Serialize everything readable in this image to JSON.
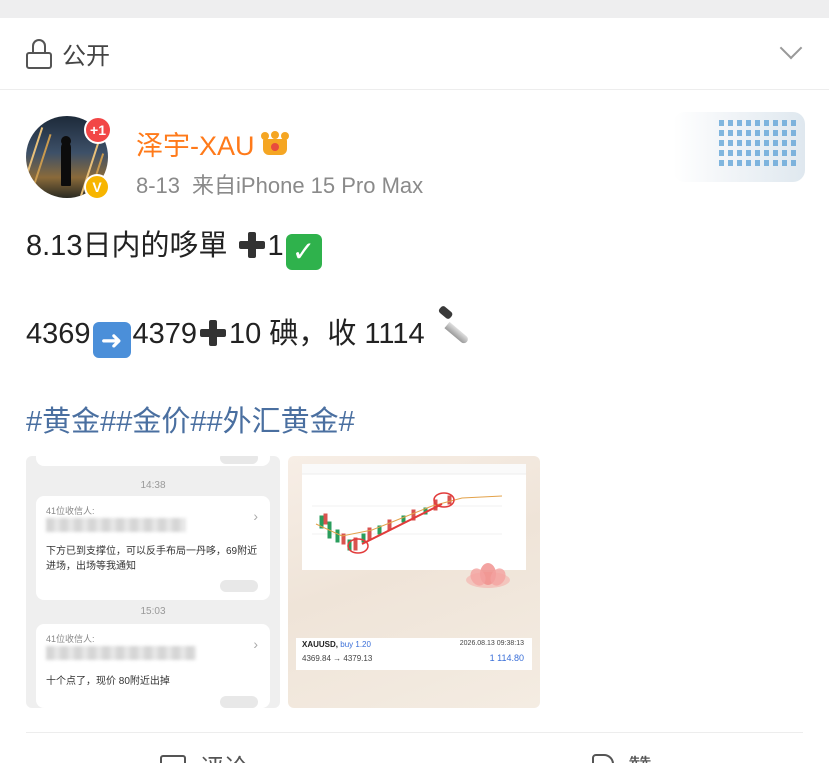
{
  "privacy": {
    "label": "公开"
  },
  "post": {
    "notification_badge": "+1",
    "verified_badge": "V",
    "username": "泽宇-XAU",
    "date": "8-13",
    "source": "来自iPhone 15 Pro Max",
    "text_line1_a": "8.13日内的哆單",
    "text_line1_b": "1",
    "text_line2_a": "4369",
    "text_line2_b": "4379",
    "text_line2_c": "10 碘，收 1114",
    "hashtags": "#黄金##金价##外汇黄金#"
  },
  "images": {
    "chat": {
      "time1": "14:38",
      "from1": "41位收信人:",
      "msg1": "下方已到支撑位，可以反手布局一丹哆，69附近进场，出场等我通知",
      "time2": "15:03",
      "from2": "41位收信人:",
      "msg2": "十个点了，现价 80附近出掉"
    },
    "trade": {
      "symbol": "XAUUSD,",
      "side": "buy 1.20",
      "datetime": "2026.08.13 09:38:13",
      "prices": "4369.84 → 4379.13",
      "profit": "1 114.80"
    }
  },
  "actions": {
    "comment_label": "评论",
    "like_label": "赞"
  },
  "icons": [
    "lock-icon",
    "chevron-down-icon",
    "crown-icon",
    "plus-icon",
    "check-icon",
    "arrow-right-icon",
    "knife-icon",
    "comment-icon",
    "like-icon"
  ],
  "colors": {
    "username": "#ff7a1a",
    "hashtag": "#4a6fa0",
    "meta": "#8a8a8a",
    "badge_red": "#f24646",
    "verified": "#f7b500"
  }
}
